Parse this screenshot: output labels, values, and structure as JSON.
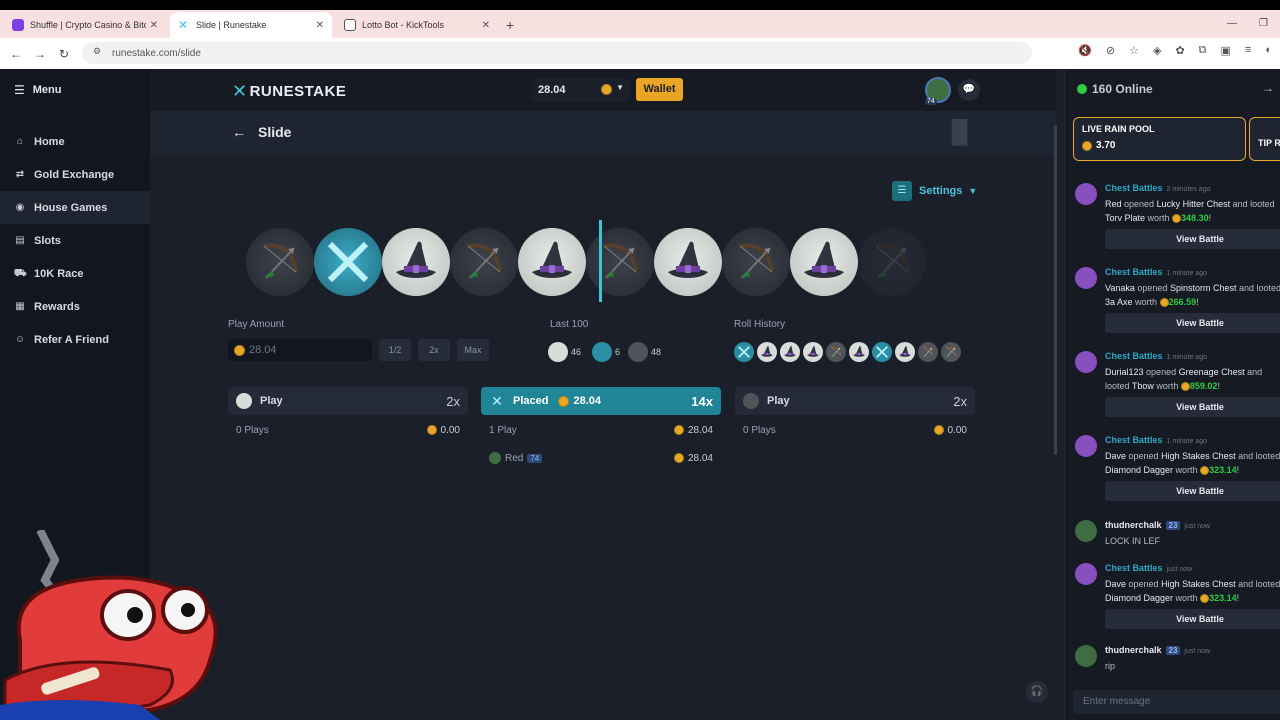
{
  "browser": {
    "tabs": [
      {
        "title": "Shuffle | Crypto Casino & Bitcoi",
        "color": "#7b3fe4"
      },
      {
        "title": "Slide | Runestake",
        "color": "#3ec4d8"
      },
      {
        "title": "Lotto Bot - KickTools",
        "color": "#555555"
      }
    ],
    "url": "runestake.com/slide"
  },
  "sidebar": {
    "menu_label": "Menu",
    "items": [
      {
        "label": "Home",
        "icon": "home-icon"
      },
      {
        "label": "Gold Exchange",
        "icon": "exchange-icon"
      },
      {
        "label": "House Games",
        "icon": "gamepad-icon"
      },
      {
        "label": "Slots",
        "icon": "slots-icon"
      },
      {
        "label": "10K Race",
        "icon": "car-icon"
      },
      {
        "label": "Rewards",
        "icon": "gift-icon"
      },
      {
        "label": "Refer A Friend",
        "icon": "user-plus-icon"
      }
    ]
  },
  "header": {
    "logo": "RUNESTAKE",
    "balance": "28.04",
    "wallet_label": "Wallet",
    "avatar_level": "74"
  },
  "page": {
    "title": "Slide",
    "settings_label": "Settings"
  },
  "reel": [
    "bow",
    "sword",
    "hat",
    "bow",
    "hat",
    "bow",
    "hat",
    "bow",
    "hat"
  ],
  "controls": {
    "play_amount_label": "Play Amount",
    "play_amount_value": "28.04",
    "half_label": "1/2",
    "double_label": "2x",
    "max_label": "Max",
    "last100_label": "Last 100",
    "last100": {
      "hat": "46",
      "sword": "6",
      "bow": "48"
    },
    "roll_history_label": "Roll History",
    "roll_history": [
      "sword",
      "hat",
      "hat",
      "hat",
      "bow",
      "hat",
      "sword",
      "hat",
      "bow",
      "bow"
    ]
  },
  "bets": [
    {
      "head": "Play",
      "mult": "2x",
      "plays": "0 Plays",
      "total": "0.00"
    },
    {
      "head": "Placed",
      "amount": "28.04",
      "mult": "14x",
      "plays": "1 Play",
      "total": "28.04",
      "player": "Red",
      "player_level": "74",
      "player_amount": "28.04"
    },
    {
      "head": "Play",
      "mult": "2x",
      "plays": "0 Plays",
      "total": "0.00"
    }
  ],
  "chat": {
    "online": "160 Online",
    "rain_pool_label": "LIVE RAIN POOL",
    "rain_pool_value": "3.70",
    "tip_label": "TIP R",
    "view_battle": "View Battle",
    "input_placeholder": "Enter message",
    "messages": [
      {
        "name": "Chest Battles",
        "time": "2 minutes ago",
        "user": "Red",
        "pre": "opened",
        "chest": "Lucky Hitter Chest",
        "mid": "and looted",
        "item": "Torv Plate",
        "worth": "348.30"
      },
      {
        "name": "Chest Battles",
        "time": "1 minute ago",
        "user": "Vanaka",
        "pre": "opened",
        "chest": "Spinstorm Chest",
        "mid": "and looted",
        "item": "3a Axe",
        "worth": "266.59"
      },
      {
        "name": "Chest Battles",
        "time": "1 minute ago",
        "user": "Durial123",
        "pre": "opened",
        "chest": "Greenage Chest",
        "mid": "and looted",
        "item": "Tbow",
        "worth": "859.02"
      },
      {
        "name": "Chest Battles",
        "time": "1 minute ago",
        "user": "Dave",
        "pre": "opened",
        "chest": "High Stakes Chest",
        "mid": "and looted",
        "item": "Diamond Dagger",
        "worth": "323.14"
      },
      {
        "name": "thudnerchalk",
        "level": "23",
        "time": "just now",
        "text": "LOCK IN LEF"
      },
      {
        "name": "Chest Battles",
        "time": "just now",
        "user": "Dave",
        "pre": "opened",
        "chest": "High Stakes Chest",
        "mid": "and looted",
        "item": "Diamond Dagger",
        "worth": "323.14"
      },
      {
        "name": "thudnerchalk",
        "level": "23",
        "time": "just now",
        "text": "rip"
      }
    ]
  }
}
